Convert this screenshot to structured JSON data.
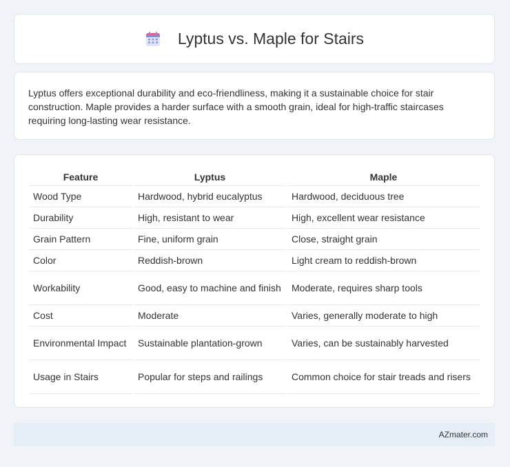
{
  "header": {
    "title": "Lyptus vs. Maple for Stairs",
    "icon": "calendar-icon"
  },
  "intro": {
    "text": "Lyptus offers exceptional durability and eco-friendliness, making it a sustainable choice for stair construction. Maple provides a harder surface with a smooth grain, ideal for high-traffic staircases requiring long-lasting wear resistance."
  },
  "table": {
    "headers": [
      "Feature",
      "Lyptus",
      "Maple"
    ],
    "rows": [
      [
        "Wood Type",
        "Hardwood, hybrid eucalyptus",
        "Hardwood, deciduous tree"
      ],
      [
        "Durability",
        "High, resistant to wear",
        "High, excellent wear resistance"
      ],
      [
        "Grain Pattern",
        "Fine, uniform grain",
        "Close, straight grain"
      ],
      [
        "Color",
        "Reddish-brown",
        "Light cream to reddish-brown"
      ],
      [
        "Workability",
        "Good, easy to machine and finish",
        "Moderate, requires sharp tools"
      ],
      [
        "Cost",
        "Moderate",
        "Varies, generally moderate to high"
      ],
      [
        "Environmental Impact",
        "Sustainable plantation-grown",
        "Varies, can be sustainably harvested"
      ],
      [
        "Usage in Stairs",
        "Popular for steps and railings",
        "Common choice for stair treads and risers"
      ]
    ]
  },
  "footer": {
    "brand": "AZmater.com"
  }
}
